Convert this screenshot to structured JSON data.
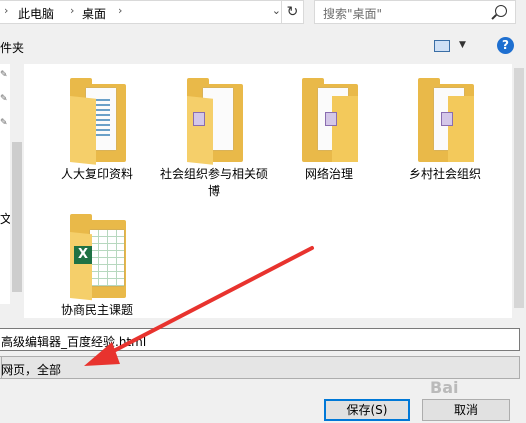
{
  "breadcrumb": {
    "items": [
      "此电脑",
      "桌面"
    ]
  },
  "search": {
    "placeholder": "搜索\"桌面\""
  },
  "toolbar": {
    "fragment": "件夹"
  },
  "nav": {
    "fragment": "文"
  },
  "files": [
    {
      "name": "人大复印资料",
      "icon": "folder-document-icon"
    },
    {
      "name": "社会组织参与相关硕博",
      "icon": "folder-image-icon"
    },
    {
      "name": "网络治理",
      "icon": "folder-image-icon"
    },
    {
      "name": "乡村社会组织",
      "icon": "folder-image-icon"
    },
    {
      "name": "协商民主课题",
      "icon": "folder-excel-icon"
    }
  ],
  "filename": {
    "value": "高级编辑器_百度经验.html"
  },
  "filetype": {
    "value": "网页，全部"
  },
  "buttons": {
    "save": "保存(S)",
    "cancel": "取消"
  },
  "watermark": "Bai",
  "colors": {
    "accent": "#0078d7",
    "arrow": "#e8332e",
    "folder": "#e9b949"
  }
}
